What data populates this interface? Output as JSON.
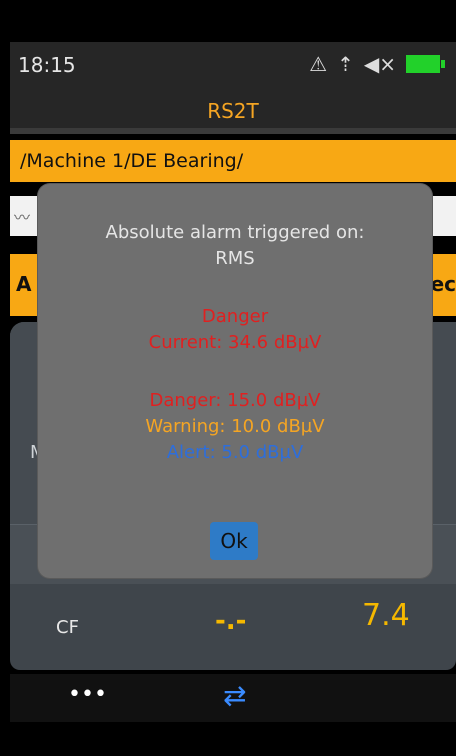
{
  "status": {
    "time": "18:15",
    "icons": [
      "hearing-warning-icon",
      "usb-icon",
      "speaker-muted-icon",
      "battery-icon"
    ]
  },
  "app": {
    "title": "RS2T"
  },
  "path": {
    "text": "/Machine 1/DE Bearing/"
  },
  "row": {
    "left_letter": "A",
    "right_letters": "ec"
  },
  "panel": {
    "left_letter": "M"
  },
  "cf": {
    "label": "CF",
    "dash_value": "-.-",
    "value": "7.4"
  },
  "bottom": {
    "more": "•••",
    "swap_icon": "⇄"
  },
  "dialog": {
    "line1": "Absolute alarm triggered on:",
    "line2": "RMS",
    "danger_title": "Danger",
    "current": "Current: 34.6 dBµV",
    "danger": "Danger: 15.0 dBµV",
    "warning": "Warning: 10.0 dBµV",
    "alert": "Alert: 5.0 dBµV",
    "ok": "Ok"
  },
  "colors": {
    "accent": "#f8a814",
    "danger": "#e02020",
    "warning": "#f5a523",
    "alert": "#2d6edc",
    "button": "#2e7bc7"
  }
}
